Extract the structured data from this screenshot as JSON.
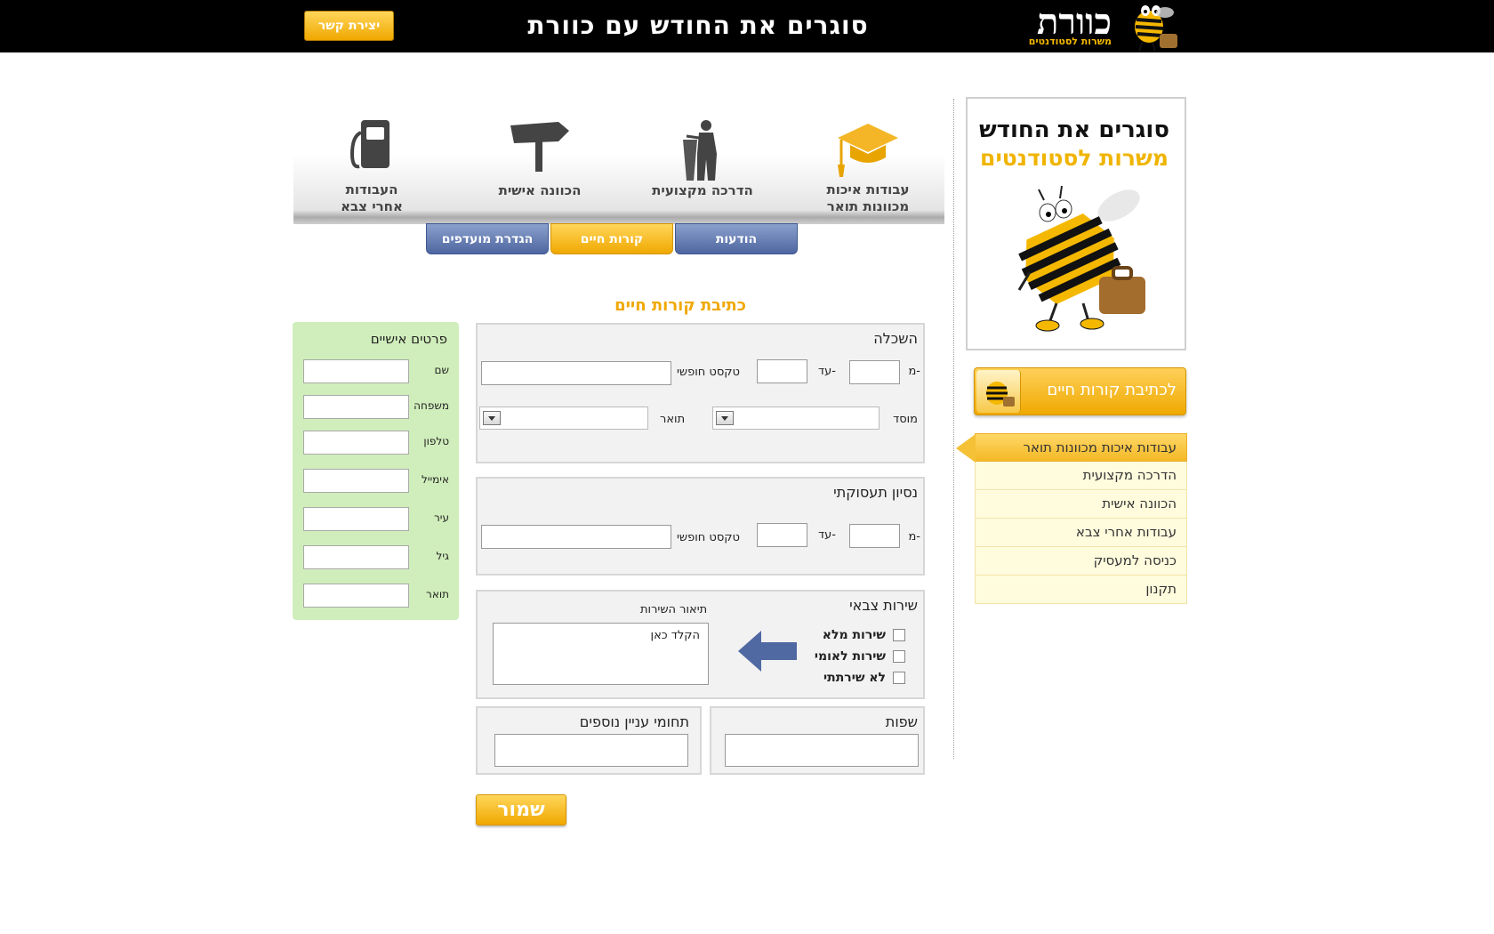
{
  "header": {
    "contact_label": "יצירת קשר",
    "title": "סוגרים את החודש עם כוורת",
    "logo_text": "כוורת",
    "logo_sub": "משרות לסטודנטים"
  },
  "promo": {
    "line1": "סוגרים את החודש",
    "line2": "משרות לסטודנטים"
  },
  "cv_button": "לכתיבת קורות חיים",
  "categories": [
    {
      "label": "עבודות איכות מכוונות תואר",
      "active": true
    },
    {
      "label": "הדרכה מקצועית"
    },
    {
      "label": "הכוונה אישית"
    },
    {
      "label": "עבודות אחרי צבא"
    },
    {
      "label": "כניסה למעסיק"
    },
    {
      "label": "תקנון"
    }
  ],
  "icons": [
    {
      "line1": "עבודות איכות",
      "line2": "מכוונות תואר",
      "icon": "graduation-cap-icon"
    },
    {
      "line1": "הדרכה מקצועית",
      "line2": "",
      "icon": "lecturer-icon"
    },
    {
      "line1": "הכוונה אישית",
      "line2": "",
      "icon": "signpost-icon"
    },
    {
      "line1": "העבודות",
      "line2": "אחרי צבא",
      "icon": "fuel-pump-icon"
    }
  ],
  "tabs": {
    "messages": "הודעות",
    "cv": "קורות חיים",
    "preferences": "הגדרת מועדפים"
  },
  "form": {
    "title": "כתיבת קורות חיים",
    "education": {
      "title": "השכלה",
      "from": "מ-",
      "to": "עד-",
      "free_text": "טקסט חופשי",
      "institution": "מוסד",
      "degree": "תואר"
    },
    "experience": {
      "title": "נסיון תעסוקתי",
      "from": "מ-",
      "to": "עד-",
      "free_text": "טקסט חופשי"
    },
    "military": {
      "title": "שירות צבאי",
      "options": [
        "שירות מלא",
        "שירות לאומי",
        "לא שירתתי"
      ],
      "desc_label": "תיאור השירות",
      "desc_placeholder": "הקלד כאן"
    },
    "languages": "שפות",
    "interests": "תחומי עניין נוספים",
    "save": "שמור"
  },
  "personal": {
    "title": "פרטים אישיים",
    "fields": [
      "שם",
      "משפחה",
      "טלפון",
      "אימייל",
      "עיר",
      "גיל",
      "תואר"
    ]
  },
  "colors": {
    "accent_gold": "#f0a800",
    "tab_blue": "#4e66a0",
    "panel_green": "#d0eebb"
  }
}
